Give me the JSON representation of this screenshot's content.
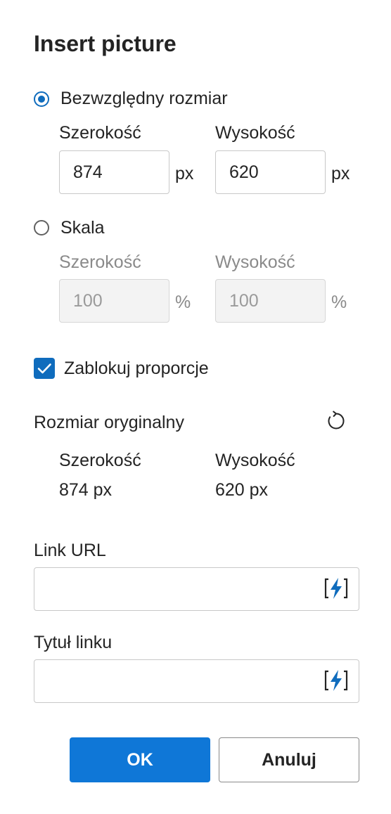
{
  "dialog": {
    "title": "Insert picture"
  },
  "absolute": {
    "option_label": "Bezwzględny rozmiar",
    "width_label": "Szerokość",
    "height_label": "Wysokość",
    "width_value": "874",
    "height_value": "620",
    "unit": "px",
    "selected": true
  },
  "scale": {
    "option_label": "Skala",
    "width_label": "Szerokość",
    "height_label": "Wysokość",
    "width_value": "100",
    "height_value": "100",
    "unit": "%",
    "selected": false
  },
  "lock": {
    "label": "Zablokuj proporcje",
    "checked": true
  },
  "original": {
    "label": "Rozmiar oryginalny",
    "width_label": "Szerokość",
    "height_label": "Wysokość",
    "width_value": "874 px",
    "height_value": "620 px"
  },
  "link": {
    "url_label": "Link URL",
    "url_value": "",
    "title_label": "Tytuł linku",
    "title_value": ""
  },
  "buttons": {
    "ok": "OK",
    "cancel": "Anuluj"
  },
  "colors": {
    "accent": "#0f6cbd",
    "primary_button": "#0f77d7"
  },
  "icons": {
    "reset": "refresh-icon",
    "dynamic_content": "insert-dynamic-content-icon"
  }
}
